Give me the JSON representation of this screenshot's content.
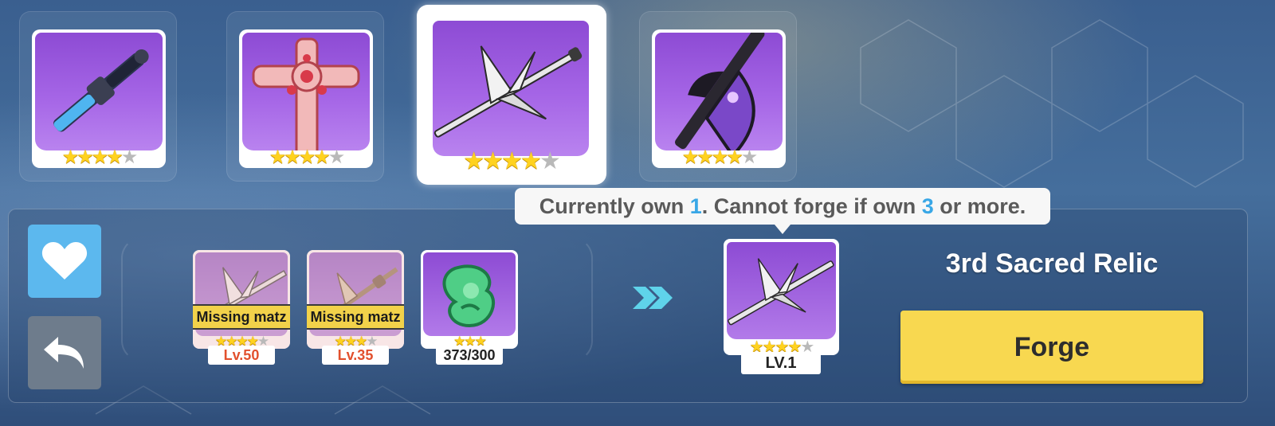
{
  "weapon_list": [
    {
      "name": "weapon-slot-1",
      "stars_filled": 4,
      "stars_total": 5,
      "selected": false
    },
    {
      "name": "weapon-slot-2",
      "stars_filled": 4,
      "stars_total": 5,
      "selected": false
    },
    {
      "name": "weapon-slot-3",
      "stars_filled": 4,
      "stars_total": 5,
      "selected": true
    },
    {
      "name": "weapon-slot-4",
      "stars_filled": 4,
      "stars_total": 5,
      "selected": false
    }
  ],
  "tooltip": {
    "prefix": "Currently own ",
    "owned": "1",
    "middle": ". Cannot forge if own ",
    "limit": "3",
    "suffix": " or more."
  },
  "side_buttons": {
    "favorite_icon": "heart-icon",
    "back_icon": "undo-arrow-icon"
  },
  "materials": [
    {
      "badge": "Missing matz",
      "stars_filled": 4,
      "stars_total": 5,
      "label": "Lv.50",
      "missing": true
    },
    {
      "badge": "Missing matz",
      "stars_filled": 3,
      "stars_total": 4,
      "label": "Lv.35",
      "missing": true
    },
    {
      "badge": "",
      "stars_filled": 3,
      "stars_total": 3,
      "label": "373/300",
      "missing": false
    }
  ],
  "result": {
    "stars_filled": 4,
    "stars_total": 5,
    "level": "LV.1"
  },
  "relic_name": "3rd Sacred Relic",
  "forge_label": "Forge",
  "colors": {
    "card_purple": "#9b5be0",
    "star_gold": "#ffd21f",
    "forge_yellow": "#f8d850",
    "favorite_blue": "#5cb8ee",
    "highlight_blue": "#39a7e6",
    "level_red": "#e2502d"
  }
}
